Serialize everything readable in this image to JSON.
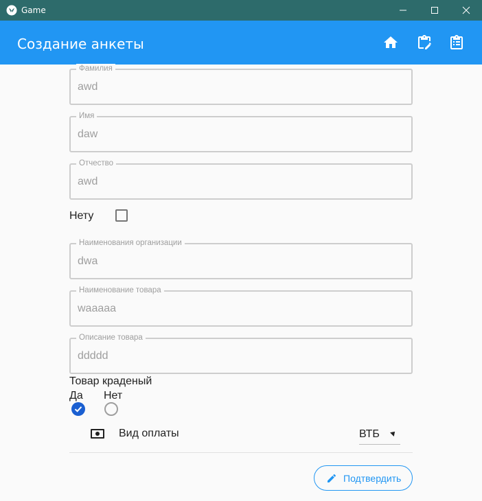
{
  "window": {
    "title": "Game"
  },
  "appbar": {
    "title": "Создание анкеты",
    "accent": "#2196f3",
    "actions": [
      "home-icon",
      "clipboard-edit-icon",
      "clipboard-list-icon"
    ]
  },
  "form": {
    "surname": {
      "label": "Фамилия",
      "value": "awd"
    },
    "name": {
      "label": "Имя",
      "value": "daw"
    },
    "patronymic": {
      "label": "Отчество",
      "value": "awd"
    },
    "no_patronymic": {
      "label": "Нету",
      "checked": false
    },
    "organization": {
      "label": "Наименования организации",
      "value": "dwa"
    },
    "product_name": {
      "label": "Наименование товара",
      "value": "waaaaa"
    },
    "product_description": {
      "label": "Описание товара",
      "value": "ddddd"
    },
    "stolen": {
      "label": "Товар краденый",
      "yes_label": "Да",
      "no_label": "Нет",
      "selected": "Да"
    },
    "payment": {
      "label": "Вид оплаты",
      "icon": "cash-icon",
      "value": "ВТБ"
    },
    "submit_label": "Подтвердить"
  }
}
